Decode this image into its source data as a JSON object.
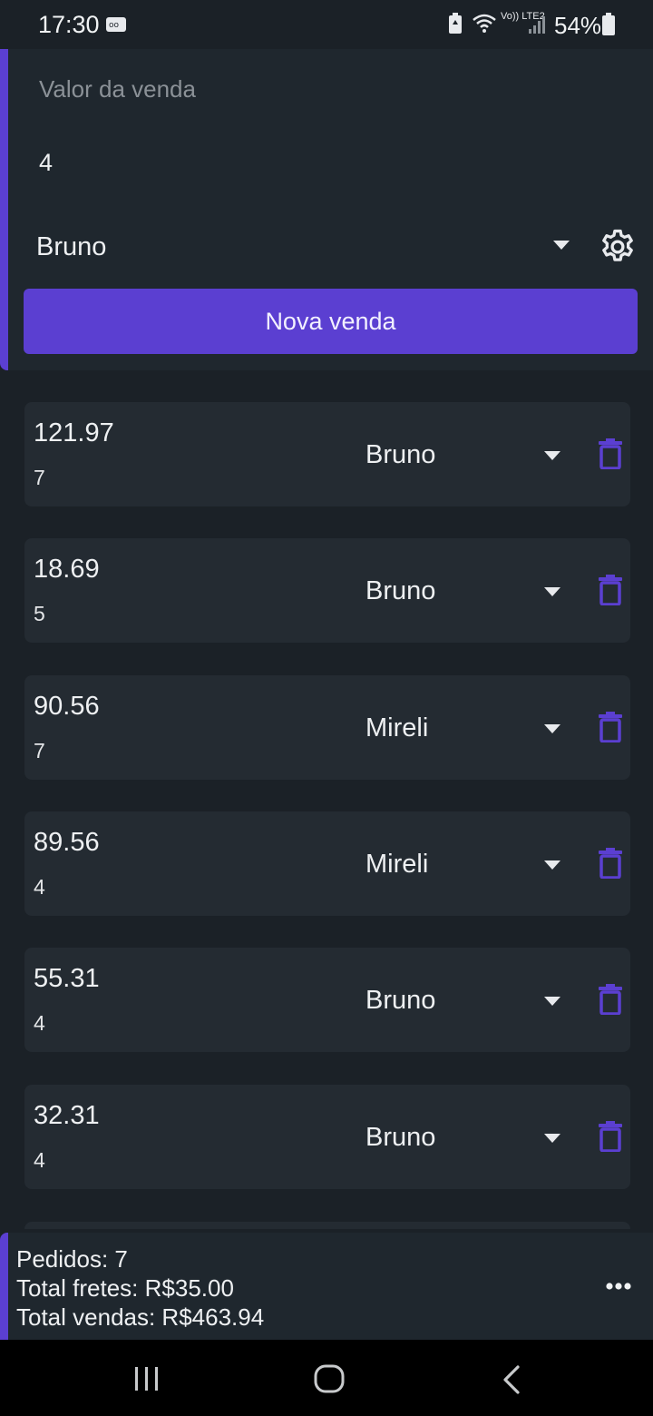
{
  "status_bar": {
    "time": "17:30",
    "battery": "54%",
    "network": "Vo)) LTE2"
  },
  "form": {
    "value_placeholder": "Valor da venda",
    "shipping_value": "4",
    "seller_selected": "Bruno",
    "new_sale_label": "Nova venda"
  },
  "sales": [
    {
      "value": "121.97",
      "shipping": "7",
      "seller": "Bruno"
    },
    {
      "value": "18.69",
      "shipping": "5",
      "seller": "Bruno"
    },
    {
      "value": "90.56",
      "shipping": "7",
      "seller": "Mireli"
    },
    {
      "value": "89.56",
      "shipping": "4",
      "seller": "Mireli"
    },
    {
      "value": "55.31",
      "shipping": "4",
      "seller": "Bruno"
    },
    {
      "value": "32.31",
      "shipping": "4",
      "seller": "Bruno"
    }
  ],
  "summary": {
    "orders": "Pedidos: 7",
    "total_shipping": "Total fretes: R$35.00",
    "total_sales": "Total vendas: R$463.94"
  },
  "colors": {
    "accent": "#5b3fd1",
    "background": "#1b2127",
    "card": "#242b32"
  },
  "icons": [
    "settings-gear-icon",
    "dropdown-caret-icon",
    "trash-icon",
    "more-vert-icon",
    "recents-icon",
    "home-icon",
    "back-icon"
  ]
}
